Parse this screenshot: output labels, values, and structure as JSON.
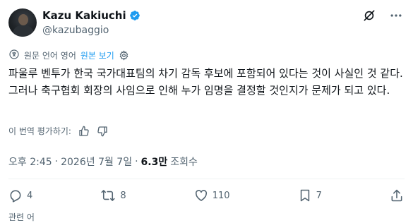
{
  "author": {
    "display_name": "Kazu Kakiuchi",
    "handle": "@kazubaggio",
    "verified": true,
    "verified_color": "#1d9bf0"
  },
  "header_actions": {
    "grok_icon": "grok-icon",
    "more_icon": "more-dots-icon"
  },
  "translation": {
    "language_note": "원문 언어 영어",
    "show_original": "원본 보기",
    "settings_icon": "gear-icon"
  },
  "tweet": {
    "text": "파울루 벤투가 한국 국가대표팀의 차기 감독 후보에 포함되어 있다는 것이 사실인 것 같다. 그러나 축구협회 회장의 사임으로 인해 누가 임명을 결정할 것인지가 문제가 되고 있다."
  },
  "rate_translation": {
    "label": "이 번역 평가하기:",
    "thumbs_up_icon": "thumbs-up-icon",
    "thumbs_down_icon": "thumbs-down-icon"
  },
  "meta": {
    "time": "오후 2:45",
    "separator": "·",
    "date": "2026년 7월 7일",
    "views_count": "6.3만",
    "views_label": "조회수"
  },
  "actions": {
    "reply_count": "4",
    "repost_count": "8",
    "like_count": "110",
    "bookmark_count": "7"
  },
  "colors": {
    "accent": "#1d9bf0",
    "text_primary": "#0f1419",
    "text_secondary": "#536471"
  },
  "bottom_peek_text": "관련 어"
}
